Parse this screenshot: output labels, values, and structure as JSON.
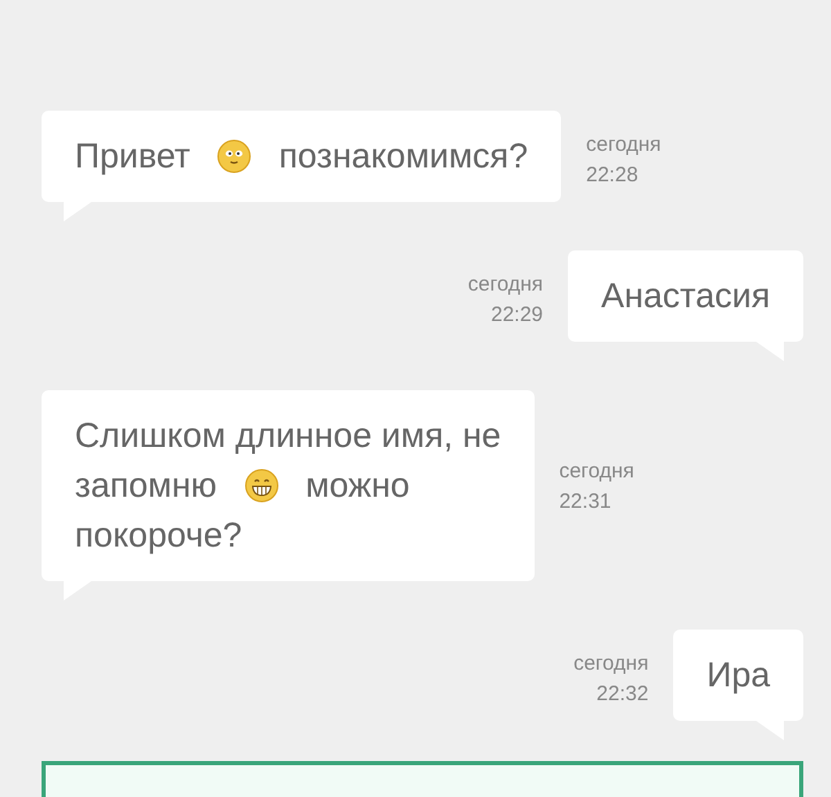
{
  "messages": [
    {
      "kind": "incoming",
      "lines": [
        [
          {
            "kind": "text",
            "text": "Привет"
          },
          {
            "kind": "smile"
          },
          {
            "kind": "text",
            "text": "познакомимся?"
          }
        ]
      ],
      "day": "сегодня",
      "time": "22:28"
    },
    {
      "kind": "outgoing",
      "lines": [
        [
          {
            "kind": "text",
            "text": "Анастасия"
          }
        ]
      ],
      "day": "сегодня",
      "time": "22:29"
    },
    {
      "kind": "incoming",
      "lines": [
        [
          {
            "kind": "text",
            "text": "Слишком длинное имя, не"
          }
        ],
        [
          {
            "kind": "text",
            "text": "запомню"
          },
          {
            "kind": "grin"
          },
          {
            "kind": "text",
            "text": "можно"
          }
        ],
        [
          {
            "kind": "text",
            "text": "покороче?"
          }
        ]
      ],
      "day": "сегодня",
      "time": "22:31"
    },
    {
      "kind": "outgoing",
      "lines": [
        [
          {
            "kind": "text",
            "text": "Ира"
          }
        ]
      ],
      "day": "сегодня",
      "time": "22:32"
    }
  ]
}
